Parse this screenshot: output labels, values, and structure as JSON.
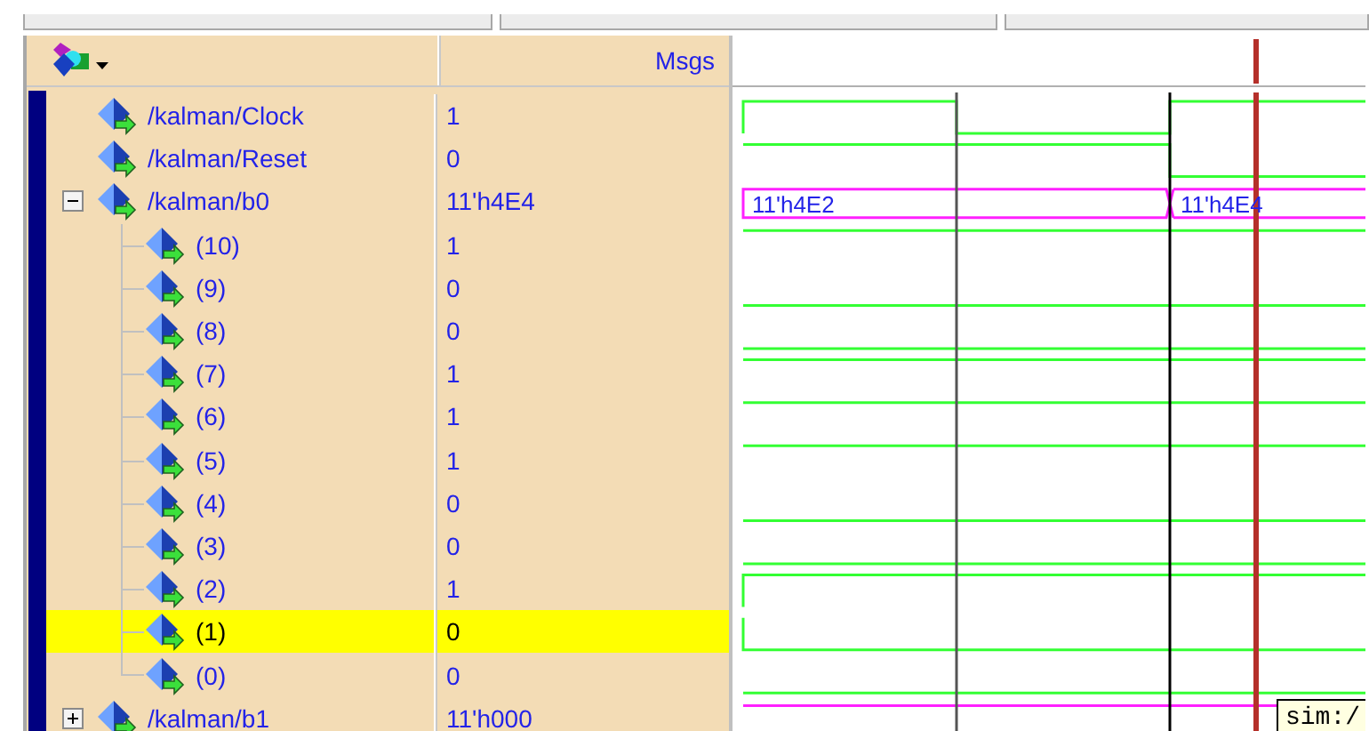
{
  "header": {
    "value_column": "Msgs"
  },
  "signals": [
    {
      "name": "/kalman/Clock",
      "value": "1",
      "selected": false,
      "kind": "bit"
    },
    {
      "name": "/kalman/Reset",
      "value": "0",
      "selected": false,
      "kind": "bit"
    },
    {
      "name": "/kalman/b0",
      "value": "11'h4E4",
      "selected": false,
      "kind": "bus",
      "expanded": true,
      "wave_labels": [
        "11'h4E2",
        "11'h4E4"
      ],
      "children": [
        {
          "name": "(10)",
          "value": "1",
          "selected": false
        },
        {
          "name": "(9)",
          "value": "0",
          "selected": false
        },
        {
          "name": "(8)",
          "value": "0",
          "selected": false
        },
        {
          "name": "(7)",
          "value": "1",
          "selected": false
        },
        {
          "name": "(6)",
          "value": "1",
          "selected": false
        },
        {
          "name": "(5)",
          "value": "1",
          "selected": false
        },
        {
          "name": "(4)",
          "value": "0",
          "selected": false
        },
        {
          "name": "(3)",
          "value": "0",
          "selected": false
        },
        {
          "name": "(2)",
          "value": "1",
          "selected": false
        },
        {
          "name": "(1)",
          "value": "0",
          "selected": true
        },
        {
          "name": "(0)",
          "value": "0",
          "selected": false
        }
      ]
    },
    {
      "name": "/kalman/b1",
      "value": "11'h000",
      "selected": false,
      "kind": "bus",
      "expanded": false
    }
  ],
  "tooltip": "sim:/"
}
